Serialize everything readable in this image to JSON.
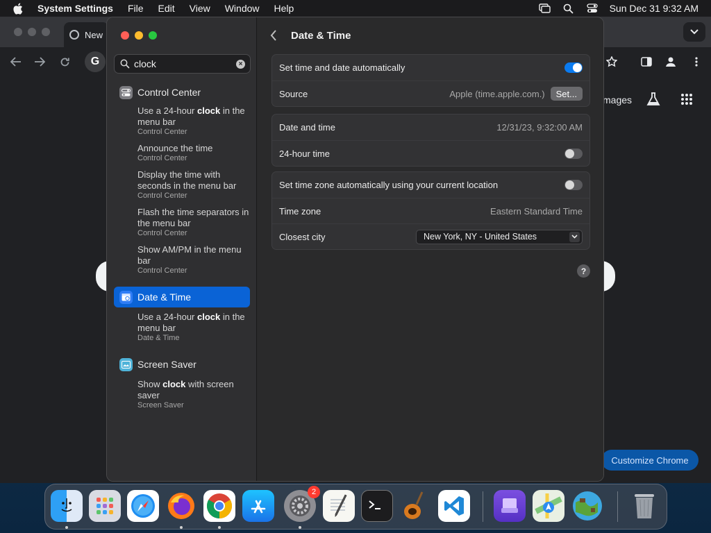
{
  "menubar": {
    "app_name": "System Settings",
    "items": [
      "File",
      "Edit",
      "View",
      "Window",
      "Help"
    ],
    "clock": "Sun Dec 31  9:32 AM"
  },
  "chrome": {
    "tab_title": "New",
    "images_link": "mages",
    "customize_button": "Customize Chrome",
    "google_letter": "G"
  },
  "sidebar": {
    "search": {
      "value": "clock",
      "placeholder": "Search"
    },
    "sections": [
      {
        "title": "Control Center",
        "results": [
          {
            "pre": "Use a 24-hour ",
            "bold": "clock",
            "post": " in the menu bar",
            "source": "Control Center"
          },
          {
            "pre": "Announce the time",
            "bold": "",
            "post": "",
            "source": "Control Center"
          },
          {
            "pre": "Display the time with seconds in the menu bar",
            "bold": "",
            "post": "",
            "source": "Control Center"
          },
          {
            "pre": "Flash the time separators in the menu bar",
            "bold": "",
            "post": "",
            "source": "Control Center"
          },
          {
            "pre": "Show AM/PM in the menu bar",
            "bold": "",
            "post": "",
            "source": "Control Center"
          }
        ]
      },
      {
        "title": "Date & Time",
        "results": [
          {
            "pre": "Use a 24-hour ",
            "bold": "clock",
            "post": " in the menu bar",
            "source": "Date & Time"
          }
        ]
      },
      {
        "title": "Screen Saver",
        "results": [
          {
            "pre": "Show ",
            "bold": "clock",
            "post": " with screen saver",
            "source": "Screen Saver"
          }
        ]
      }
    ]
  },
  "content": {
    "title": "Date & Time",
    "group1": {
      "auto_label": "Set time and date automatically",
      "auto_on": true,
      "source_label": "Source",
      "source_value": "Apple (time.apple.com.)",
      "set_button": "Set..."
    },
    "group2": {
      "datetime_label": "Date and time",
      "datetime_value": "12/31/23, 9:32:00 AM",
      "h24_label": "24-hour time",
      "h24_on": false
    },
    "group3": {
      "tz_auto_label": "Set time zone automatically using your current location",
      "tz_auto_on": false,
      "tz_label": "Time zone",
      "tz_value": "Eastern Standard Time",
      "city_label": "Closest city",
      "city_value": "New York, NY - United States"
    },
    "help": "?"
  },
  "dock": {
    "settings_badge": "2",
    "apps": [
      "finder",
      "launchpad",
      "safari",
      "firefox",
      "chrome",
      "app-store",
      "system-settings",
      "textedit",
      "terminal",
      "garageband",
      "vscode",
      "podcasts-like",
      "maps",
      "minecraft",
      "trash"
    ]
  },
  "colors": {
    "accent": "#0a63d6",
    "toggle_on": "#0a7bf0",
    "badge": "#ff3b30"
  }
}
